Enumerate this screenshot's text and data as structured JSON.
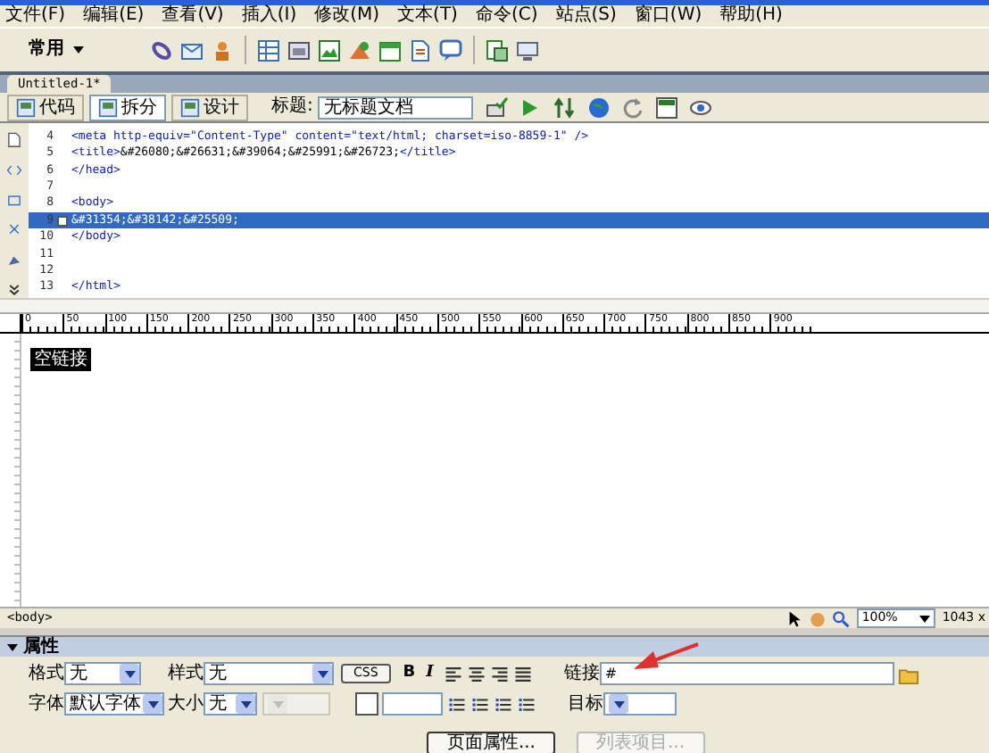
{
  "menu": [
    "文件(F)",
    "编辑(E)",
    "查看(V)",
    "插入(I)",
    "修改(M)",
    "文本(T)",
    "命令(C)",
    "站点(S)",
    "窗口(W)",
    "帮助(H)"
  ],
  "toolbar": {
    "category": "常用"
  },
  "document": {
    "tab": "Untitled-1*",
    "views": [
      {
        "label": "代码",
        "selected": false
      },
      {
        "label": "拆分",
        "selected": true
      },
      {
        "label": "设计",
        "selected": false
      }
    ],
    "title_label": "标题:",
    "title_value": "无标题文档"
  },
  "code": {
    "lines": [
      {
        "number": "4",
        "text": "<meta http-equiv=\"Content-Type\" content=\"text/html; charset=iso-8859-1\" />",
        "selected": false,
        "fold_marker": false
      },
      {
        "number": "5",
        "text": "<title>&#26080;&#26631;&#39064;&#25991;&#26723;</title>",
        "selected": false,
        "fold_marker": false
      },
      {
        "number": "6",
        "text": "</head>",
        "selected": false,
        "fold_marker": false
      },
      {
        "number": "7",
        "selected": false,
        "fold_marker": false
      },
      {
        "number": "8",
        "text": "<body>",
        "selected": false,
        "fold_marker": false
      },
      {
        "number": "9",
        "text": "&#31354;&#38142;&#25509;",
        "selected": true,
        "fold_marker": true
      },
      {
        "number": "10",
        "text": "</body>",
        "selected": false,
        "fold_marker": false
      },
      {
        "number": "11",
        "selected": false,
        "fold_marker": false
      },
      {
        "number": "12",
        "selected": false,
        "fold_marker": false
      },
      {
        "number": "13",
        "text": "</html>",
        "selected": false,
        "fold_marker": false
      }
    ]
  },
  "ruler": [
    "0",
    "50",
    "100",
    "150",
    "200",
    "250",
    "300",
    "350",
    "400",
    "450",
    "500",
    "550",
    "600",
    "650",
    "700",
    "750",
    "800",
    "850",
    "900"
  ],
  "design": {
    "text": "空链接",
    "selected": true
  },
  "status_bar": {
    "tag": "<body>",
    "zoom": "100%",
    "size": "1043 x"
  },
  "properties": {
    "title": "属性",
    "format_label": "格式",
    "format_value": "无",
    "style_label": "样式",
    "style_value": "无",
    "css_button": "CSS",
    "bold": "B",
    "italic": "I",
    "link_label": "链接",
    "link_value": "#",
    "font_label": "字体",
    "font_value": "默认字体",
    "size_label": "大小",
    "size_value": "无",
    "target_label": "目标",
    "buttons": [
      {
        "label": "页面属性...",
        "disabled": false
      },
      {
        "label": "列表项目...",
        "disabled": true
      }
    ]
  }
}
